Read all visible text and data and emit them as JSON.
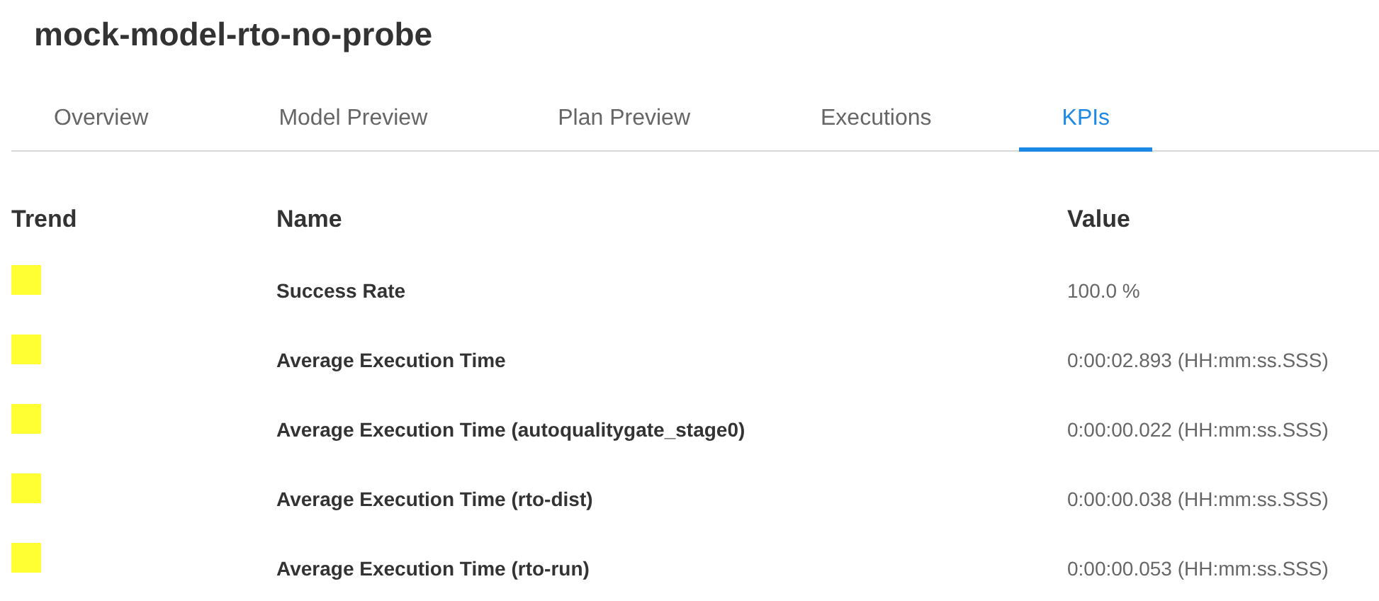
{
  "title": "mock-model-rto-no-probe",
  "tabs": [
    {
      "label": "Overview",
      "selected": false
    },
    {
      "label": "Model Preview",
      "selected": false
    },
    {
      "label": "Plan Preview",
      "selected": false
    },
    {
      "label": "Executions",
      "selected": false
    },
    {
      "label": "KPIs",
      "selected": true
    }
  ],
  "table": {
    "columns": [
      "Trend",
      "Name",
      "Value"
    ],
    "rows": [
      {
        "color": "#ffff33",
        "name": "Success Rate",
        "value": "100.0 %"
      },
      {
        "color": "#ffff33",
        "name": "Average Execution Time",
        "value": "0:00:02.893 (HH:mm:ss.SSS)"
      },
      {
        "color": "#ffff33",
        "name": "Average Execution Time (autoqualitygate_stage0)",
        "value": "0:00:00.022 (HH:mm:ss.SSS)"
      },
      {
        "color": "#ffff33",
        "name": "Average Execution Time (rto-dist)",
        "value": "0:00:00.038 (HH:mm:ss.SSS)"
      },
      {
        "color": "#ffff33",
        "name": "Average Execution Time (rto-run)",
        "value": "0:00:00.053 (HH:mm:ss.SSS)"
      }
    ]
  }
}
